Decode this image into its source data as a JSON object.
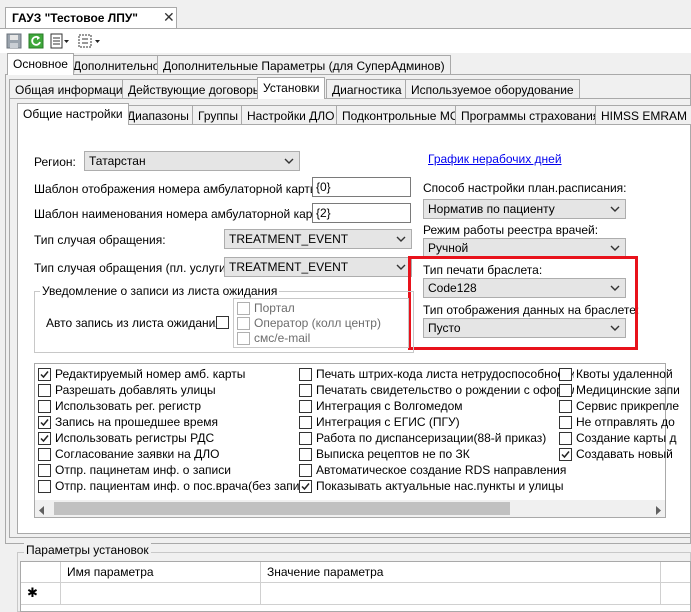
{
  "document_tab": {
    "title": "ГАУЗ \"Тестовое ЛПУ\"",
    "close": "✕"
  },
  "toolbar": {
    "icons": [
      "save-icon",
      "refresh-icon",
      "print-icon",
      "export-icon"
    ]
  },
  "tabs_level1": [
    {
      "label": "Основное",
      "active": true
    },
    {
      "label": "Дополнительно",
      "active": false
    },
    {
      "label": "Дополнительные Параметры (для СуперАдминов)",
      "active": false
    }
  ],
  "tabs_level2": [
    {
      "label": "Общая информация",
      "active": false
    },
    {
      "label": "Действующие договоры",
      "active": false
    },
    {
      "label": "Установки",
      "active": true
    },
    {
      "label": "Диагностика",
      "active": false
    },
    {
      "label": "Используемое оборудование",
      "active": false
    }
  ],
  "tabs_level3": [
    {
      "label": "Общие настройки",
      "active": true
    },
    {
      "label": "Диапазоны",
      "active": false
    },
    {
      "label": "Группы",
      "active": false
    },
    {
      "label": "Настройки ДЛО",
      "active": false
    },
    {
      "label": "Подконтрольные МО",
      "active": false
    },
    {
      "label": "Программы страхования",
      "active": false
    },
    {
      "label": "HIMSS EMRAM",
      "active": false
    }
  ],
  "form": {
    "region_label": "Регион:",
    "region_value": "Татарстан",
    "holidays_link": "График нерабочих дней",
    "card_number_template_label": "Шаблон отображения номера амбулаторной карты:",
    "card_number_template_value": "{0}",
    "card_name_template_label": "Шаблон наименования номера амбулаторной карты:",
    "card_name_template_value": "{2}",
    "schedule_method_label": "Способ настройки план.расписания:",
    "schedule_method_value": "Норматив по пациенту",
    "case_type_label": "Тип случая обращения:",
    "case_type_value": "TREATMENT_EVENT",
    "registry_mode_label": "Режим работы реестра врачей:",
    "registry_mode_value": "Ручной",
    "case_type_paid_label": "Тип случая обращения (пл. услуги):",
    "case_type_paid_value": "TREATMENT_EVENT",
    "bracelet_print_label": "Тип печати браслета:",
    "bracelet_print_value": "Code128",
    "bracelet_display_label": "Тип отображения данных на браслете:",
    "bracelet_display_value": "Пусто"
  },
  "waitlist_group": {
    "title": "Уведомление о записи из листа ожидания",
    "auto_label": "Авто запись из листа ожидания",
    "options": [
      "Портал",
      "Оператор (колл центр)",
      "смс/e-mail"
    ]
  },
  "checkbox_columns": [
    [
      {
        "label": "Редактируемый номер амб. карты",
        "checked": true
      },
      {
        "label": "Разрешать добавлять улицы",
        "checked": false
      },
      {
        "label": "Использовать рег. регистр",
        "checked": false
      },
      {
        "label": "Запись на прошедшее время",
        "checked": true
      },
      {
        "label": "Использовать регистры РДС",
        "checked": true
      },
      {
        "label": "Согласование заявки на ДЛО",
        "checked": false
      },
      {
        "label": "Отпр. пацинетам инф. о записи",
        "checked": false
      },
      {
        "label": "Отпр. пациентам инф. о пос.врача(без записи)",
        "checked": false
      }
    ],
    [
      {
        "label": "Печать штрих-кода листа нетрудоспособности",
        "checked": false
      },
      {
        "label": "Печатать свидетельство о рождении с оформл",
        "checked": false
      },
      {
        "label": "Интеграция с Волгомедом",
        "checked": false
      },
      {
        "label": "Интеграция с ЕГИС (ПГУ)",
        "checked": false
      },
      {
        "label": "Работа по диспансеризации(88-й приказ)",
        "checked": false
      },
      {
        "label": "Выписка рецептов не по ЗК",
        "checked": false
      },
      {
        "label": "Автоматическое создание RDS направления",
        "checked": false
      },
      {
        "label": "Показывать актуальные нас.пункты и улицы",
        "checked": true
      }
    ],
    [
      {
        "label": "Квоты удаленной",
        "checked": false
      },
      {
        "label": "Медицинские запи",
        "checked": false
      },
      {
        "label": "Сервис прикрепле",
        "checked": false
      },
      {
        "label": "Не отправлять до",
        "checked": false
      },
      {
        "label": "Создание карты д",
        "checked": false
      },
      {
        "label": "Создавать новый",
        "checked": true
      }
    ]
  ],
  "params_section": {
    "title": "Параметры установок",
    "columns": [
      "Имя параметра",
      "Значение параметра"
    ],
    "new_row_marker": "✱"
  },
  "colors": {
    "highlight": "#e8121b",
    "link": "#0000ee"
  }
}
